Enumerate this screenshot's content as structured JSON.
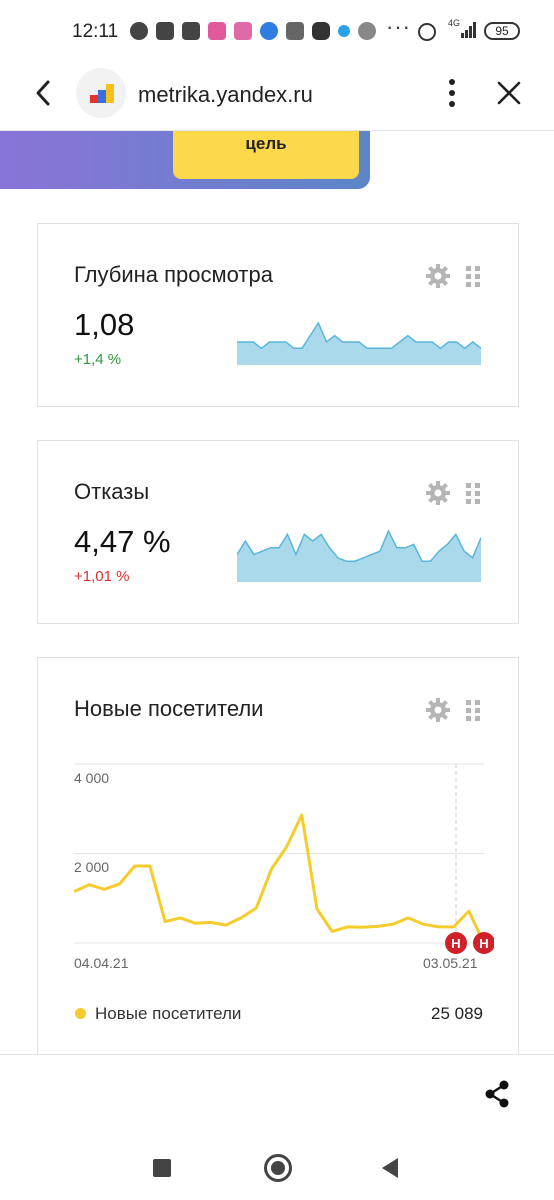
{
  "status_bar": {
    "time": "12:11",
    "network": "4G",
    "battery": "95"
  },
  "browser": {
    "url": "metrika.yandex.ru"
  },
  "banner": {
    "button_label": "цель"
  },
  "cards": [
    {
      "title": "Глубина просмотра",
      "value": "1,08",
      "delta": "+1,4 %",
      "delta_color": "#2e9a3b"
    },
    {
      "title": "Отказы",
      "value": "4,47 %",
      "delta": "+1,01 %",
      "delta_color": "#d33333"
    },
    {
      "title": "Новые посетители",
      "legend_label": "Новые посетители",
      "legend_value": "25 089",
      "annotation_label": "Н"
    }
  ],
  "chart_data": [
    {
      "type": "area",
      "series": [
        {
          "values": [
            1.08,
            1.08,
            1.08,
            1.07,
            1.08,
            1.08,
            1.08,
            1.07,
            1.07,
            1.09,
            1.11,
            1.08,
            1.09,
            1.08,
            1.08,
            1.08,
            1.07,
            1.07,
            1.07,
            1.07,
            1.08,
            1.09,
            1.08,
            1.08,
            1.08,
            1.07,
            1.08,
            1.08,
            1.07,
            1.08,
            1.07
          ]
        }
      ],
      "color": "#a9d9ea",
      "line_color": "#59b6d8"
    },
    {
      "type": "area",
      "series": [
        {
          "values": [
            4.3,
            4.7,
            4.3,
            4.4,
            4.5,
            4.5,
            4.9,
            4.3,
            4.9,
            4.7,
            4.9,
            4.5,
            4.2,
            4.1,
            4.1,
            4.2,
            4.3,
            4.4,
            5.0,
            4.5,
            4.5,
            4.6,
            4.1,
            4.1,
            4.4,
            4.6,
            4.9,
            4.4,
            4.2,
            4.8
          ]
        }
      ],
      "color": "#a9d9ea",
      "line_color": "#59b6d8"
    },
    {
      "type": "line",
      "x": [
        "04.04.21",
        "05.04.21",
        "06.04.21",
        "07.04.21",
        "08.04.21",
        "09.04.21",
        "10.04.21",
        "11.04.21",
        "12.04.21",
        "13.04.21",
        "14.04.21",
        "15.04.21",
        "16.04.21",
        "17.04.21",
        "18.04.21",
        "19.04.21",
        "20.04.21",
        "21.04.21",
        "22.04.21",
        "23.04.21",
        "24.04.21",
        "25.04.21",
        "26.04.21",
        "27.04.21",
        "28.04.21",
        "29.04.21",
        "30.04.21",
        "01.05.21",
        "02.05.21",
        "03.05.21",
        "04.05.21"
      ],
      "series": [
        {
          "name": "Новые посетители",
          "values": [
            1150,
            1300,
            1200,
            1320,
            1720,
            1720,
            480,
            560,
            440,
            460,
            400,
            560,
            780,
            1650,
            2150,
            2860,
            760,
            260,
            360,
            350,
            370,
            420,
            560,
            420,
            360,
            360,
            710,
            0
          ]
        }
      ],
      "x_ticks": [
        "04.04.21",
        "03.05.21"
      ],
      "y_ticks": [
        "4 000",
        "2 000"
      ],
      "ylim": [
        0,
        4000
      ],
      "color": "#f5cc2c",
      "grid": true
    }
  ]
}
